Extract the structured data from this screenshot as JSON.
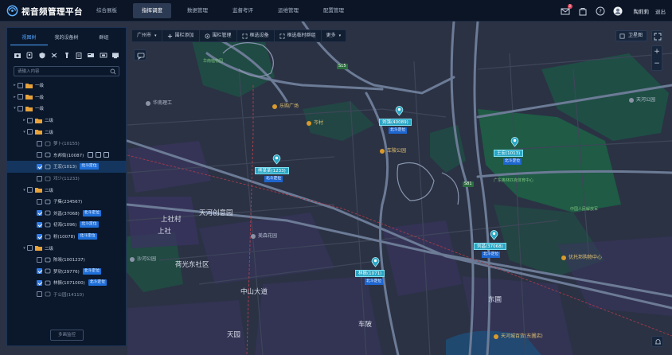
{
  "app": {
    "title": "视音频管理平台"
  },
  "nav": [
    {
      "label": "综合展板",
      "active": false
    },
    {
      "label": "指挥调度",
      "active": true
    },
    {
      "label": "数据管理",
      "active": false
    },
    {
      "label": "监督考评",
      "active": false
    },
    {
      "label": "运维管理",
      "active": false
    },
    {
      "label": "配置管理",
      "active": false
    }
  ],
  "user": {
    "name": "陶莉莉",
    "logout": "退出",
    "mail_badge": "3"
  },
  "panel": {
    "tabs": [
      "视图树",
      "我的设备树",
      "群组"
    ],
    "search_placeholder": "请输入内容",
    "button": "多画监控",
    "tree": [
      {
        "label": "一级",
        "type": "folder",
        "level": 0,
        "expanded": false,
        "checked": false
      },
      {
        "label": "一级",
        "type": "folder",
        "level": 0,
        "expanded": false,
        "checked": false
      },
      {
        "label": "一级",
        "type": "folder",
        "level": 0,
        "expanded": true,
        "checked": false
      },
      {
        "label": "二级",
        "type": "folder",
        "level": 1,
        "expanded": false,
        "checked": false
      },
      {
        "label": "二级",
        "type": "folder",
        "level": 1,
        "expanded": true,
        "checked": false
      },
      {
        "label": "萝卜(10155)",
        "type": "camera",
        "level": 2,
        "checked": false,
        "tag": "",
        "offline": true
      },
      {
        "label": "东邦街(10087)",
        "type": "camera",
        "level": 2,
        "checked": false,
        "tag": "",
        "tools": true
      },
      {
        "label": "王宏(1013)",
        "type": "camera",
        "level": 2,
        "checked": true,
        "tag": "北斗定位",
        "selected": true
      },
      {
        "label": "邓少(11233)",
        "type": "camera",
        "level": 2,
        "checked": false,
        "tag": "",
        "offline": true
      },
      {
        "label": "二级",
        "type": "folder",
        "level": 1,
        "expanded": true,
        "checked": false
      },
      {
        "label": "子集(234567)",
        "type": "camera",
        "level": 2,
        "checked": false,
        "tag": ""
      },
      {
        "label": "刘昌(37068)",
        "type": "camera",
        "level": 2,
        "checked": true,
        "tag": "北斗定位"
      },
      {
        "label": "初海(1096)",
        "type": "camera",
        "level": 2,
        "checked": true,
        "tag": "北斗定位"
      },
      {
        "label": "粉(10078)",
        "type": "camera",
        "level": 2,
        "checked": true,
        "tag": "北斗定位"
      },
      {
        "label": "二级",
        "type": "folder",
        "level": 1,
        "expanded": true,
        "checked": false
      },
      {
        "label": "陈晓(1001237)",
        "type": "camera",
        "level": 2,
        "checked": false,
        "tag": ""
      },
      {
        "label": "梦欣(29776)",
        "type": "camera",
        "level": 2,
        "checked": true,
        "tag": "北斗定位"
      },
      {
        "label": "林振(1071000)",
        "type": "camera",
        "level": 2,
        "checked": true,
        "tag": "北斗定位"
      },
      {
        "label": "于公园(14110)",
        "type": "camera",
        "level": 2,
        "checked": false,
        "tag": "",
        "offline": true
      }
    ]
  },
  "toolbar": {
    "city": "广州市",
    "items": [
      "围栏添加",
      "围栏管理",
      "框选设备",
      "框选临时群组",
      "更多"
    ]
  },
  "map_controls": {
    "satellite": "卫星图",
    "zoom_in": "+",
    "zoom_out": "−"
  },
  "markers": [
    {
      "name": "刘强(40089)",
      "tag": "北斗定位"
    },
    {
      "name": "熊某某(1233)",
      "tag": "北斗定位"
    },
    {
      "name": "王宏(1013)",
      "tag": "北斗定位"
    },
    {
      "name": "刘昌(37068)",
      "tag": "北斗定位"
    },
    {
      "name": "林振(1071)",
      "tag": "北斗定位"
    }
  ],
  "map_labels": {
    "districts": [
      "天河创意园",
      "上社村",
      "上社",
      "荷光东社区",
      "中山大道",
      "天园",
      "车陂",
      "东圃"
    ],
    "pois": [
      "沙河公园",
      "华南植物园",
      "广东奥林匹克体育中心",
      "优托邦购物中心",
      "天河城百货(东圃店)",
      "华南理工",
      "乐购广场",
      "美森花园",
      "车陂公园",
      "岑村",
      "天河公园",
      "中国人民解放军"
    ],
    "roads": [
      "S15",
      "S81"
    ]
  },
  "colors": {
    "accent": "#2f7bea",
    "marker": "#2aa6c4",
    "background": "#0c1424"
  }
}
